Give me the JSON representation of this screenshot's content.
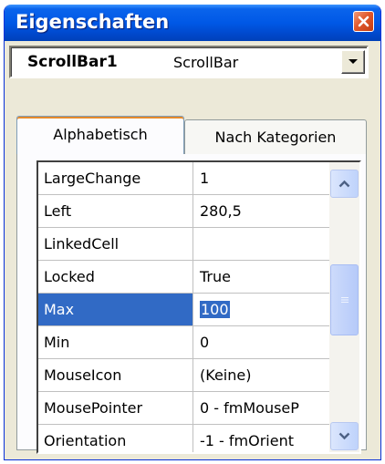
{
  "window": {
    "title": "Eigenschaften",
    "close_icon": "close-icon"
  },
  "object_selector": {
    "name": "ScrollBar1",
    "type": "ScrollBar"
  },
  "tabs": [
    {
      "label": "Alphabetisch",
      "active": true
    },
    {
      "label": "Nach Kategorien",
      "active": false
    }
  ],
  "properties": [
    {
      "name": "LargeChange",
      "value": "1"
    },
    {
      "name": "Left",
      "value": "280,5"
    },
    {
      "name": "LinkedCell",
      "value": ""
    },
    {
      "name": "Locked",
      "value": "True"
    },
    {
      "name": "Max",
      "value": "100",
      "selected": true
    },
    {
      "name": "Min",
      "value": "0"
    },
    {
      "name": "MouseIcon",
      "value": "(Keine)"
    },
    {
      "name": "MousePointer",
      "value": "0 - fmMouseP"
    },
    {
      "name": "Orientation",
      "value": "-1 - fmOrient"
    }
  ],
  "colors": {
    "title_bar": "#0058e6",
    "selection": "#316ac5",
    "window_face": "#ece9d8"
  }
}
